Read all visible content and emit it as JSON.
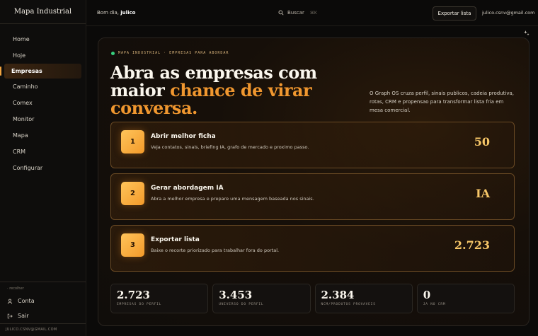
{
  "sidebar": {
    "brand": "Mapa Industrial",
    "items": [
      {
        "label": "Home"
      },
      {
        "label": "Hoje"
      },
      {
        "label": "Empresas",
        "active": true
      },
      {
        "label": "Caminho"
      },
      {
        "label": "Comex"
      },
      {
        "label": "Monitor"
      },
      {
        "label": "Mapa"
      },
      {
        "label": "CRM"
      },
      {
        "label": "Configurar"
      }
    ],
    "collapse_label": "recolher",
    "account_label": "Conta",
    "logout_label": "Sair",
    "footer_email": "JULICO.CSNV@GMAIL.COM"
  },
  "topbar": {
    "greeting_prefix": "Bom dia,",
    "user_name": "julico",
    "search_label": "Buscar",
    "search_shortcut": "⌘K",
    "export_label": "Exportar lista",
    "user_email": "julico.csnv@gmail.com"
  },
  "hero": {
    "eyebrow": "MAPA INDUSTRIAL · EMPRESAS PARA ABORDAR",
    "headline_part1": "Abra as empresas com maior ",
    "headline_accent": "chance de virar conversa.",
    "intro": "O Graph OS cruza perfil, sinais publicos, cadeia produtiva, rotas, CRM e propensao para transformar lista fria em mesa comercial."
  },
  "cards": [
    {
      "number": "1",
      "title": "Abrir melhor ficha",
      "description": "Veja contatos, sinais, briefing IA, grafo de mercado e proximo passo.",
      "metric": "50"
    },
    {
      "number": "2",
      "title": "Gerar abordagem IA",
      "description": "Abra a melhor empresa e prepare uma mensagem baseada nos sinais.",
      "metric": "IA"
    },
    {
      "number": "3",
      "title": "Exportar lista",
      "description": "Baixe o recorte priorizado para trabalhar fora do portal.",
      "metric": "2.723"
    }
  ],
  "stats": [
    {
      "value": "2.723",
      "label": "EMPRESAS DO PERFIL"
    },
    {
      "value": "3.453",
      "label": "UNIVERSO DO PERFIL"
    },
    {
      "value": "2.384",
      "label": "NCM/PRODUTOS PROVAVEIS"
    },
    {
      "value": "0",
      "label": "JA NO CRM"
    }
  ],
  "colors": {
    "accent": "#f0972f",
    "metric": "#f7c768",
    "status_dot": "#37d07e",
    "background": "#0b0a09"
  },
  "icons": {
    "search": "search-icon",
    "account": "user-icon",
    "logout": "logout-icon",
    "corner": "sparkle-icon"
  }
}
